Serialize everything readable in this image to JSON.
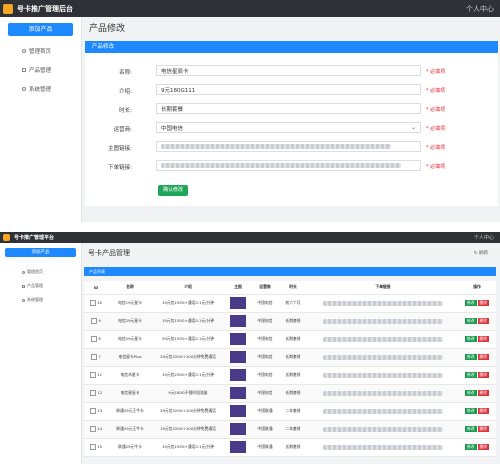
{
  "top": {
    "brand": "号卡推广管理后台",
    "personal": "个人中心",
    "add_button": "添加产品",
    "nav": [
      {
        "label": "管理首页",
        "icon": "home-icon"
      },
      {
        "label": "产品管理",
        "icon": "box-icon"
      },
      {
        "label": "系统管理",
        "icon": "user-icon"
      }
    ],
    "page_title": "产品修改",
    "panel_title": "产品修改",
    "form": {
      "name_label": "名称:",
      "name_value": "电信星辰卡",
      "intro_label": "介绍:",
      "intro_value": "9元180G111",
      "duration_label": "时长:",
      "duration_value": "长期套餐",
      "operator_label": "运营商:",
      "operator_value": "中国电信",
      "main_link_label": "主图链接:",
      "order_link_label": "下单链接:",
      "required_text": "* 必填项",
      "submit_label": "确认修改"
    }
  },
  "bottom": {
    "brand": "号卡推广管理平台",
    "personal": "个人中心",
    "add_button": "添加产品",
    "nav": [
      {
        "label": "管理首页",
        "icon": "home-icon"
      },
      {
        "label": "产品管理",
        "icon": "box-icon"
      },
      {
        "label": "系统管理",
        "icon": "user-icon"
      }
    ],
    "page_title": "号卡产品管理",
    "refresh_label": "刷新",
    "panel_title": "产品列表",
    "columns": [
      "ID",
      "名称",
      "介绍",
      "主图",
      "运营商",
      "时长",
      "下单链接",
      "操作"
    ],
    "edit_label": "修改",
    "delete_label": "删除",
    "rows": [
      {
        "id": "10",
        "name": "电信19元星卡",
        "intro": "19元包155G+通话0.1元/分钟",
        "operator": "中国电信",
        "duration": "前六个月"
      },
      {
        "id": "9",
        "name": "电信29元星卡",
        "intro": "19元包155G+通话0.1元/分钟",
        "operator": "中国电信",
        "duration": "长期套餐"
      },
      {
        "id": "8",
        "name": "电信29元星卡",
        "intro": "29元包155G+通话0.1元/分钟",
        "operator": "中国电信",
        "duration": "长期套餐"
      },
      {
        "id": "7",
        "name": "电信星卡Plus",
        "intro": "29元包320G+100分钟免费通话",
        "operator": "中国电信",
        "duration": "长期套餐"
      },
      {
        "id": "11",
        "name": "电信木星卡",
        "intro": "19元包230G+通话0.1元/分钟",
        "operator": "中国电信",
        "duration": "长期套餐"
      },
      {
        "id": "12",
        "name": "电信星辰卡",
        "intro": "9元180G不限时段流量",
        "operator": "中国电信",
        "duration": "长期套餐"
      },
      {
        "id": "13",
        "name": "联通29元王牛卡",
        "intro": "29元包320G+100分钟免费通话",
        "operator": "中国联通",
        "duration": "二年套餐"
      },
      {
        "id": "14",
        "name": "联通29元王牛卡",
        "intro": "19元包320G+100分钟免费通话",
        "operator": "中国联通",
        "duration": "二年套餐"
      },
      {
        "id": "15",
        "name": "联通29元牛卡",
        "intro": "19元包155G+通话0.1元/分钟",
        "operator": "中国联通",
        "duration": "长期套餐"
      }
    ]
  },
  "colors": {
    "accent": "#1e88ff",
    "topbar": "#2f3136",
    "success": "#20a65a",
    "danger": "#d9353a",
    "required": "#e23"
  }
}
